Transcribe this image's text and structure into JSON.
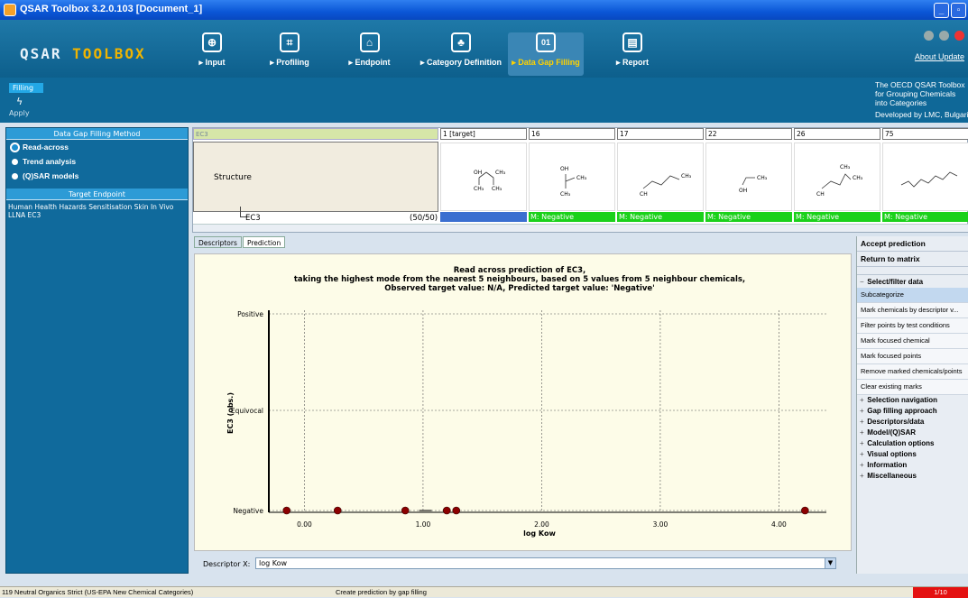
{
  "window": {
    "title": "QSAR Toolbox 3.2.0.103 [Document_1]"
  },
  "brand": {
    "word1": "QSAR",
    "word2": "TOOLBOX"
  },
  "nav": [
    {
      "label": "Input",
      "icon": "input-icon",
      "glyph": "⊕"
    },
    {
      "label": "Profiling",
      "icon": "profiling-icon",
      "glyph": "⌗"
    },
    {
      "label": "Endpoint",
      "icon": "endpoint-icon",
      "glyph": "⌂"
    },
    {
      "label": "Category Definition",
      "icon": "category-icon",
      "glyph": "♣"
    },
    {
      "label": "Data Gap Filling",
      "icon": "data-gap-filling-icon",
      "glyph": "01"
    },
    {
      "label": "Report",
      "icon": "report-icon",
      "glyph": "▤"
    }
  ],
  "topright": {
    "about": "About",
    "update": "Update"
  },
  "subbar": {
    "tab": "Filling",
    "apply": "Apply"
  },
  "oecd": [
    "The OECD QSAR Toolbox",
    "for Grouping Chemicals",
    "into Categories",
    "Developed by LMC, Bulgaria"
  ],
  "left": {
    "method_header": "Data Gap Filling Method",
    "methods": [
      "Read-across",
      "Trend analysis",
      "(Q)SAR models"
    ],
    "target_header": "Target Endpoint",
    "endpoint": "Human Health Hazards Sensitisation Skin In Vivo LLNA EC3"
  },
  "matrix": {
    "ec3_header": "EC3",
    "columns": [
      "1 [target]",
      "16",
      "17",
      "22",
      "26",
      "75"
    ],
    "structure_label": "Structure",
    "row_label": "EC3",
    "row_count": "(50/50)",
    "values": [
      "",
      "M: Negative",
      "M: Negative",
      "M: Negative",
      "M: Negative",
      "M: Negative"
    ]
  },
  "tabs": [
    "Descriptors",
    "Prediction"
  ],
  "chart_data": {
    "type": "scatter",
    "title": "Read across prediction of EC3,",
    "subtitle1": "taking the highest mode from the nearest 5 neighbours, based on 5 values from 5 neighbour chemicals,",
    "subtitle2": "Observed target value: N/A, Predicted target value: 'Negative'",
    "xlabel": "log Kow",
    "ylabel": "EC3 (obs.)",
    "categories": [
      "Negative",
      "Equivocal",
      "Positive"
    ],
    "xticks": [
      "0.00",
      "1.00",
      "2.00",
      "3.00",
      "4.00"
    ],
    "xlim": [
      -0.3,
      4.4
    ],
    "points": [
      {
        "x": -0.15,
        "y": "Negative"
      },
      {
        "x": 0.28,
        "y": "Negative"
      },
      {
        "x": 0.85,
        "y": "Negative"
      },
      {
        "x": 1.2,
        "y": "Negative"
      },
      {
        "x": 1.28,
        "y": "Negative"
      },
      {
        "x": 4.22,
        "y": "Negative"
      }
    ],
    "target": {
      "x": 1.02,
      "y": "Negative"
    },
    "point_color": "#8b0000",
    "grid": true
  },
  "descriptor": {
    "label": "Descriptor X:",
    "value": "log Kow"
  },
  "right": {
    "accept": "Accept prediction",
    "return": "Return to matrix",
    "select_header": "Select/filter data",
    "items": [
      "Subcategorize",
      "Mark chemicals by descriptor v...",
      "Filter points by test conditions",
      "Mark focused chemical",
      "Mark focused points",
      "Remove marked chemicals/points",
      "Clear existing marks"
    ],
    "sections": [
      "Selection navigation",
      "Gap filling approach",
      "Descriptors/data",
      "Model/(Q)SAR",
      "Calculation options",
      "Visual options",
      "Information",
      "Miscellaneous"
    ]
  },
  "status": {
    "left": "119  Neutral Organics Strict (US-EPA New Chemical Categories)",
    "middle": "Create prediction by gap filling",
    "right": "1/10"
  }
}
